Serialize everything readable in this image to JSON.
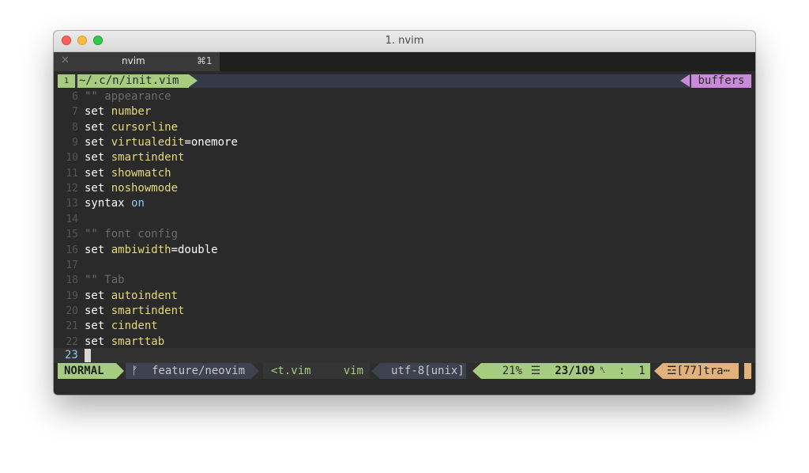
{
  "window": {
    "title": "1. nvim"
  },
  "tabbar": {
    "close_glyph": "✕",
    "tab_label": "nvim",
    "tab_shortcut": "⌘1"
  },
  "tabline": {
    "buffer_number": "1",
    "file": "~/.c/n/init.vim",
    "buffers_label": "buffers"
  },
  "editor": {
    "lines": [
      {
        "num": "6",
        "parts": [
          {
            "t": "\"\" appearance",
            "c": "cmt"
          }
        ]
      },
      {
        "num": "7",
        "parts": [
          {
            "t": "set ",
            "c": "kw"
          },
          {
            "t": "number",
            "c": "opt"
          }
        ]
      },
      {
        "num": "8",
        "parts": [
          {
            "t": "set ",
            "c": "kw"
          },
          {
            "t": "cursorline",
            "c": "opt"
          }
        ]
      },
      {
        "num": "9",
        "parts": [
          {
            "t": "set ",
            "c": "kw"
          },
          {
            "t": "virtualedit",
            "c": "opt"
          },
          {
            "t": "=onemore",
            "c": "val"
          }
        ]
      },
      {
        "num": "10",
        "parts": [
          {
            "t": "set ",
            "c": "kw"
          },
          {
            "t": "smartindent",
            "c": "opt"
          }
        ]
      },
      {
        "num": "11",
        "parts": [
          {
            "t": "set ",
            "c": "kw"
          },
          {
            "t": "showmatch",
            "c": "opt"
          }
        ]
      },
      {
        "num": "12",
        "parts": [
          {
            "t": "set ",
            "c": "kw"
          },
          {
            "t": "noshowmode",
            "c": "opt"
          }
        ]
      },
      {
        "num": "13",
        "parts": [
          {
            "t": "syntax ",
            "c": "kw"
          },
          {
            "t": "on",
            "c": "blue"
          }
        ]
      },
      {
        "num": "14",
        "parts": []
      },
      {
        "num": "15",
        "parts": [
          {
            "t": "\"\" font config",
            "c": "cmt"
          }
        ]
      },
      {
        "num": "16",
        "parts": [
          {
            "t": "set ",
            "c": "kw"
          },
          {
            "t": "ambiwidth",
            "c": "opt"
          },
          {
            "t": "=double",
            "c": "val"
          }
        ]
      },
      {
        "num": "17",
        "parts": []
      },
      {
        "num": "18",
        "parts": [
          {
            "t": "\"\" Tab",
            "c": "cmt"
          }
        ]
      },
      {
        "num": "19",
        "parts": [
          {
            "t": "set ",
            "c": "kw"
          },
          {
            "t": "autoindent",
            "c": "opt"
          }
        ]
      },
      {
        "num": "20",
        "parts": [
          {
            "t": "set ",
            "c": "kw"
          },
          {
            "t": "smartindent",
            "c": "opt"
          }
        ]
      },
      {
        "num": "21",
        "parts": [
          {
            "t": "set ",
            "c": "kw"
          },
          {
            "t": "cindent",
            "c": "opt"
          }
        ]
      },
      {
        "num": "22",
        "parts": [
          {
            "t": "set ",
            "c": "kw"
          },
          {
            "t": "smarttab",
            "c": "opt"
          }
        ]
      }
    ],
    "current_line": "23"
  },
  "statusline": {
    "mode": "NORMAL",
    "branch_icon": "ᚠ",
    "branch": "feature/neovim",
    "filename": "<t.vim",
    "filetype": "vim",
    "encoding": "utf-8[unix]",
    "percent": "21%",
    "percent_icon": "☰",
    "position": "23/109",
    "col_icon": "␤",
    "column": ":  1",
    "trailing": "☲[77]tra⋯"
  },
  "colors": {
    "mode_green": "#a6cc80",
    "buffers_purple": "#c98ad8",
    "trailing_orange": "#e3b27a",
    "segment_gray": "#3d4150",
    "editor_bg": "#2a2a2a"
  }
}
